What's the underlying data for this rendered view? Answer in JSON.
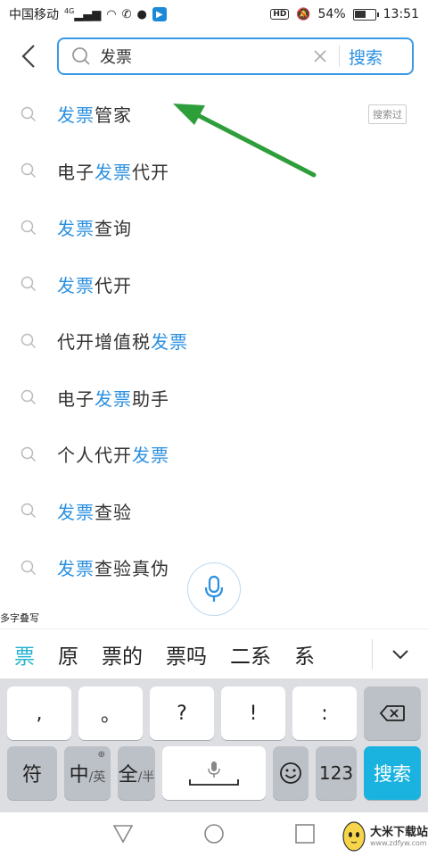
{
  "status_bar": {
    "carrier": "中国移动",
    "network": "4G",
    "battery_percent": "54%",
    "time": "13:51",
    "hd_label": "HD"
  },
  "search": {
    "back_icon": "chevron-left-icon",
    "search_icon": "search-icon",
    "query": "发票",
    "clear_icon": "close-icon",
    "button_label": "搜索",
    "accent_color": "#2b90e0"
  },
  "suggestions": [
    {
      "parts": [
        {
          "t": "发票",
          "hl": true
        },
        {
          "t": "管家",
          "hl": false
        }
      ],
      "tag": "搜索过"
    },
    {
      "parts": [
        {
          "t": "电子",
          "hl": false
        },
        {
          "t": "发票",
          "hl": true
        },
        {
          "t": "代开",
          "hl": false
        }
      ]
    },
    {
      "parts": [
        {
          "t": "发票",
          "hl": true
        },
        {
          "t": "查询",
          "hl": false
        }
      ]
    },
    {
      "parts": [
        {
          "t": "发票",
          "hl": true
        },
        {
          "t": "代开",
          "hl": false
        }
      ]
    },
    {
      "parts": [
        {
          "t": "代开增值税",
          "hl": false
        },
        {
          "t": "发票",
          "hl": true
        }
      ]
    },
    {
      "parts": [
        {
          "t": "电子",
          "hl": false
        },
        {
          "t": "发票",
          "hl": true
        },
        {
          "t": "助手",
          "hl": false
        }
      ]
    },
    {
      "parts": [
        {
          "t": "个人代开",
          "hl": false
        },
        {
          "t": "发票",
          "hl": true
        }
      ]
    },
    {
      "parts": [
        {
          "t": "发票",
          "hl": true
        },
        {
          "t": "查验",
          "hl": false
        }
      ]
    },
    {
      "parts": [
        {
          "t": "发票",
          "hl": true
        },
        {
          "t": "查验真伪",
          "hl": false
        }
      ]
    }
  ],
  "voice_button_icon": "microphone-icon",
  "ime": {
    "hint": "多字叠写",
    "candidates": [
      "票",
      "原",
      "票的",
      "票吗",
      "二系",
      "系"
    ],
    "collapse_icon": "chevron-down-icon",
    "row1": [
      ",",
      "。",
      "?",
      "!",
      ":"
    ],
    "delete_icon": "backspace-icon",
    "row2": {
      "symbol": "符",
      "lang_main": "中",
      "lang_sub": "/英",
      "width_main": "全",
      "width_sub": "/半",
      "emoji_icon": "smiley-icon",
      "numeric": "123",
      "search": "搜索"
    }
  },
  "nav": {
    "back_icon": "triangle-back-icon",
    "home_icon": "circle-home-icon",
    "recents_icon": "square-recents-icon"
  },
  "watermark": {
    "title": "大米下载站",
    "url": "www.zdfyw.com"
  }
}
